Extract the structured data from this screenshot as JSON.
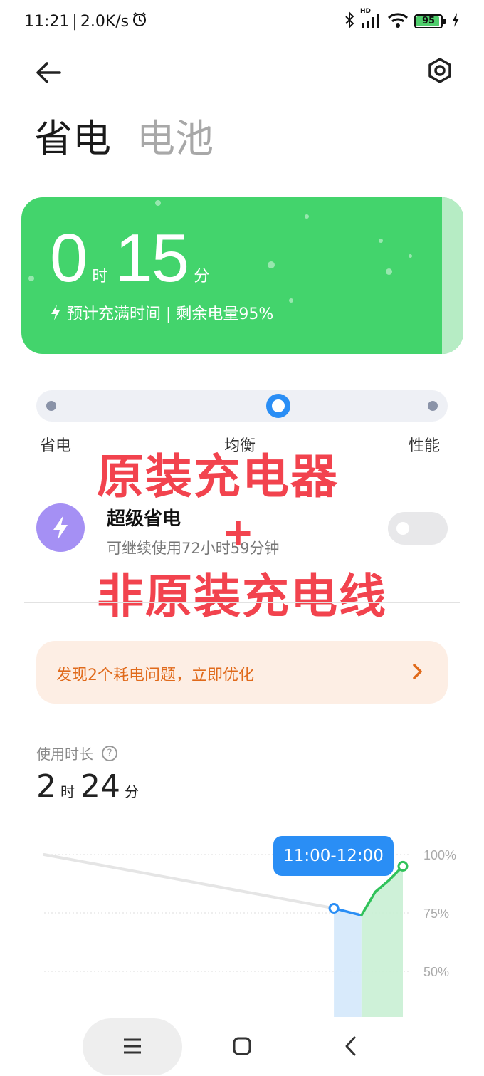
{
  "status_bar": {
    "time": "11:21",
    "separator": "|",
    "speed": "2.0K/s",
    "alarm_icon": "alarm-icon",
    "bluetooth_icon": "bluetooth-icon",
    "signal_badge": "HD",
    "signal_icon": "signal-icon",
    "wifi_icon": "wifi-icon",
    "battery_level": "95",
    "charging_icon": "bolt-icon"
  },
  "header": {
    "back_icon": "back-arrow-icon",
    "settings_icon": "settings-icon",
    "tabs": [
      {
        "label": "省电",
        "active": true
      },
      {
        "label": "电池",
        "active": false
      }
    ]
  },
  "charge_card": {
    "hours": "0",
    "hours_unit": "时",
    "minutes": "15",
    "minutes_unit": "分",
    "subtitle": "预计充满时间 | 剩余电量95%",
    "background": "#43d46c"
  },
  "mode_selector": {
    "options": [
      "省电",
      "均衡",
      "性能"
    ],
    "selected": "均衡",
    "accent": "#2a8ef5"
  },
  "overlay_text": {
    "line1": "原装充电器",
    "plus": "+",
    "line2": "非原装充电线",
    "color": "#f2434e"
  },
  "super_saver": {
    "title": "超级省电",
    "subtitle": "可继续使用72小时59分钟",
    "enabled": false,
    "icon": "bolt-icon"
  },
  "problem_banner": {
    "text": "发现2个耗电问题，立即优化",
    "arrow_icon": "chevron-right-icon"
  },
  "usage": {
    "label": "使用时长",
    "help_icon": "question-icon",
    "hours": "2",
    "hours_unit": "时",
    "minutes": "24",
    "minutes_unit": "分"
  },
  "chart_data": {
    "type": "line",
    "tooltip": "11:00-12:00",
    "y_ticks": [
      "100%",
      "75%",
      "50%"
    ],
    "ylim": [
      40,
      100
    ],
    "series": [
      {
        "color": "#e5e5e5",
        "x": [
          0,
          10.5
        ],
        "values": [
          100,
          77
        ]
      },
      {
        "color": "#2a8ef5",
        "x": [
          10.5,
          11.5
        ],
        "values": [
          77,
          74
        ]
      },
      {
        "color": "#30c25a",
        "x": [
          11.5,
          12.0,
          12.5,
          13.0
        ],
        "values": [
          74,
          84,
          89,
          95
        ]
      }
    ],
    "highlight_bars": [
      {
        "color": "#d4e8fb",
        "x_start": 10.5,
        "x_end": 11.5
      },
      {
        "color": "#c9efd4",
        "x_start": 11.5,
        "x_end": 13.0
      }
    ]
  },
  "nav_bar": {
    "menu_icon": "menu-icon",
    "home_icon": "home-icon",
    "back_icon": "back-icon"
  }
}
